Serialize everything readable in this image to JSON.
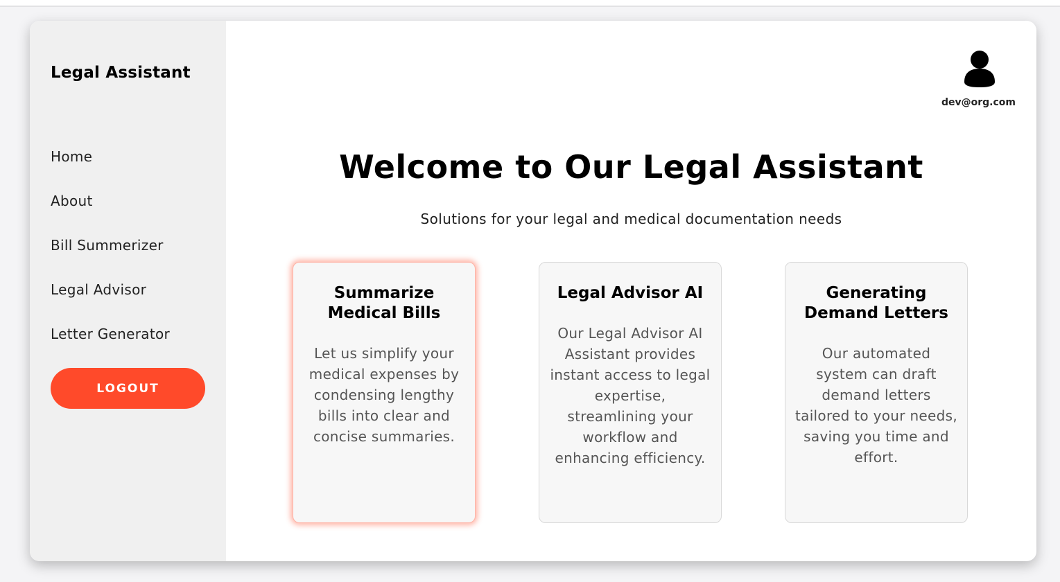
{
  "sidebar": {
    "brand": "Legal Assistant",
    "nav": [
      "Home",
      "About",
      "Bill Summerizer",
      "Legal Advisor",
      "Letter Generator"
    ],
    "logout_label": "LOGOUT"
  },
  "header": {
    "user_email": "dev@org.com",
    "avatar_icon": "user-silhouette-icon"
  },
  "hero": {
    "title": "Welcome to Our Legal Assistant",
    "subtitle": "Solutions for your legal and medical documentation needs"
  },
  "cards": [
    {
      "title": "Summarize Medical Bills",
      "text": "Let us simplify your medical expenses by condensing lengthy bills into clear and concise summaries."
    },
    {
      "title": "Legal Advisor AI",
      "text": "Our Legal Advisor AI Assistant provides instant access to legal expertise, streamlining your workflow and enhancing efficiency."
    },
    {
      "title": "Generating Demand Letters",
      "text": "Our automated system can draft demand letters tailored to your needs, saving you time and effort."
    }
  ],
  "colors": {
    "accent": "#ff4a2a",
    "sidebar_bg": "#f0f0f0",
    "card_bg": "#f7f7f7"
  }
}
